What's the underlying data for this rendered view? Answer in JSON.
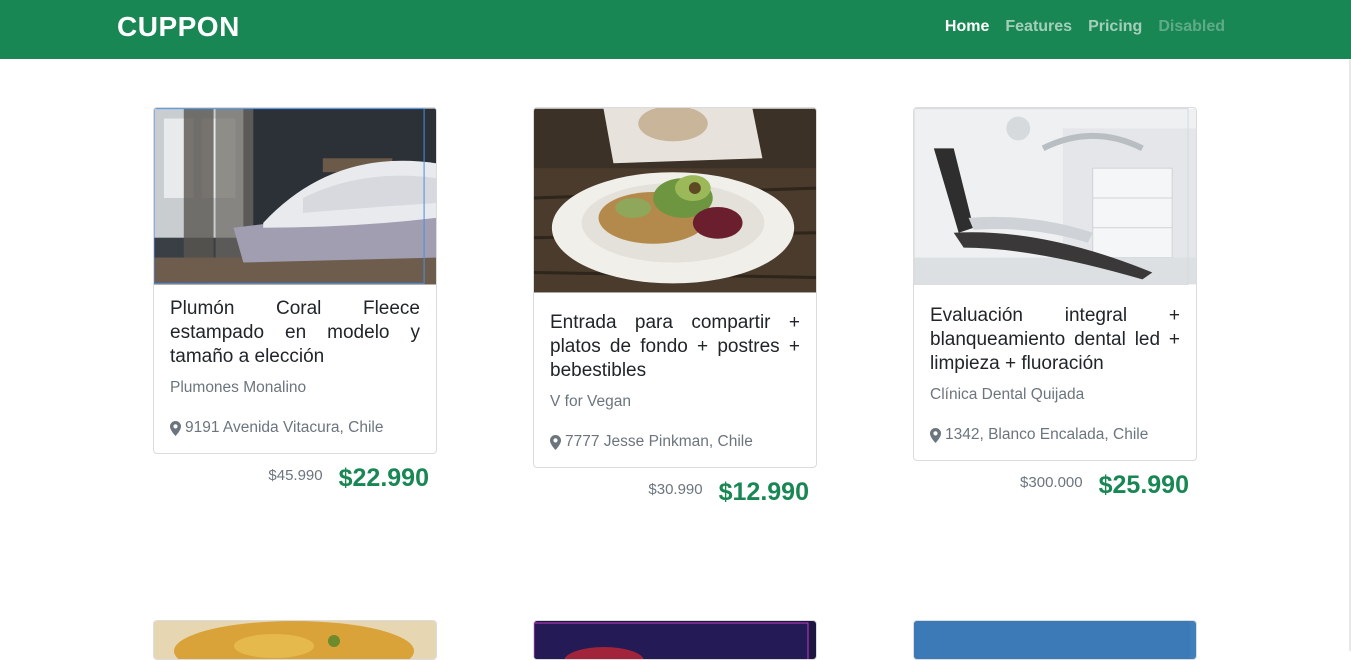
{
  "navbar": {
    "brand": "CUPPON",
    "items": [
      {
        "label": "Home",
        "state": "active"
      },
      {
        "label": "Features",
        "state": "normal"
      },
      {
        "label": "Pricing",
        "state": "normal"
      },
      {
        "label": "Disabled",
        "state": "disabled"
      }
    ]
  },
  "colors": {
    "brand_green": "#198754",
    "muted": "#6c757d"
  },
  "cards": [
    {
      "title": "Plumón Coral Fleece estampado en modelo y tamaño a elección",
      "vendor": "Plumones Monalino",
      "address": "9191 Avenida Vitacura, Chile",
      "old_price": "$45.990",
      "new_price": "$22.990",
      "image": "bedroom-photo"
    },
    {
      "title": "Entrada para compartir + platos de fondo + postres + bebestibles",
      "vendor": "V for Vegan",
      "address": "7777 Jesse Pinkman, Chile",
      "old_price": "$30.990",
      "new_price": "$12.990",
      "image": "vegan-plate-photo"
    },
    {
      "title": "Evaluación integral + blanqueamiento dental led + limpieza + fluoración",
      "vendor": "Clínica Dental Quijada",
      "address": "1342, Blanco Encalada, Chile",
      "old_price": "$300.000",
      "new_price": "$25.990",
      "image": "dental-chair-photo"
    }
  ],
  "icons": {
    "address": "map-marker-icon"
  }
}
